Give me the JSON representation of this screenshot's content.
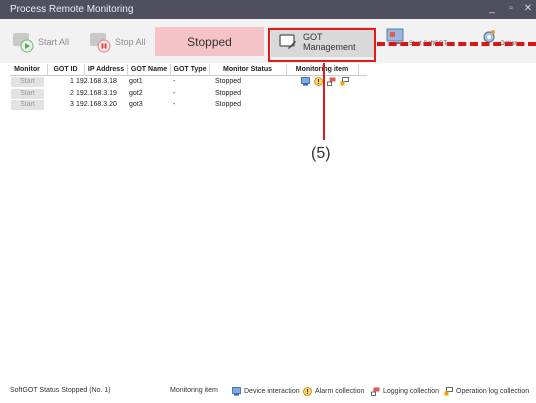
{
  "window": {
    "title": "Process Remote Monitoring",
    "minimize_glyph": "_",
    "maximize_glyph": "▫",
    "close_glyph": "✕"
  },
  "toolbar": {
    "start_all_label": "Start All",
    "stop_all_label": "Stop All",
    "status_label": "Stopped",
    "got_management_label": "GOT Management",
    "start_softgot_label": "Start SoftGOT",
    "option_label": "Option"
  },
  "table": {
    "columns": [
      "Monitor",
      "GOT ID",
      "IP Address",
      "GOT Name",
      "GOT Type",
      "Monitor Status",
      "Monitoring item"
    ],
    "rows": [
      {
        "button": "Start",
        "got_id": "1",
        "ip": "192.168.3.18",
        "name": "got1",
        "type": "-",
        "status": "Stopped",
        "has_icons": true
      },
      {
        "button": "Start",
        "got_id": "2",
        "ip": "192.168.3.19",
        "name": "got2",
        "type": "-",
        "status": "Stopped",
        "has_icons": false
      },
      {
        "button": "Start",
        "got_id": "3",
        "ip": "192.168.3.20",
        "name": "got3",
        "type": "-",
        "status": "Stopped",
        "has_icons": false
      }
    ]
  },
  "callout": {
    "label": "(5)"
  },
  "statusbar": {
    "softgot_status": "SoftGOT Status Stopped (No. 1)",
    "monitoring_item": "Monitoring item",
    "device_interaction": "Device interaction",
    "alarm_collection": "Alarm collection",
    "logging_collection": "Logging collection",
    "operation_log_collection": "Operation log collection"
  },
  "colors": {
    "titlebar": "#4f4f5f",
    "stopped_bg": "#f6c3c8",
    "highlight_red": "#e21a1a",
    "alarm_orange": "#f0a500",
    "device_blue": "#3a7bd5"
  }
}
